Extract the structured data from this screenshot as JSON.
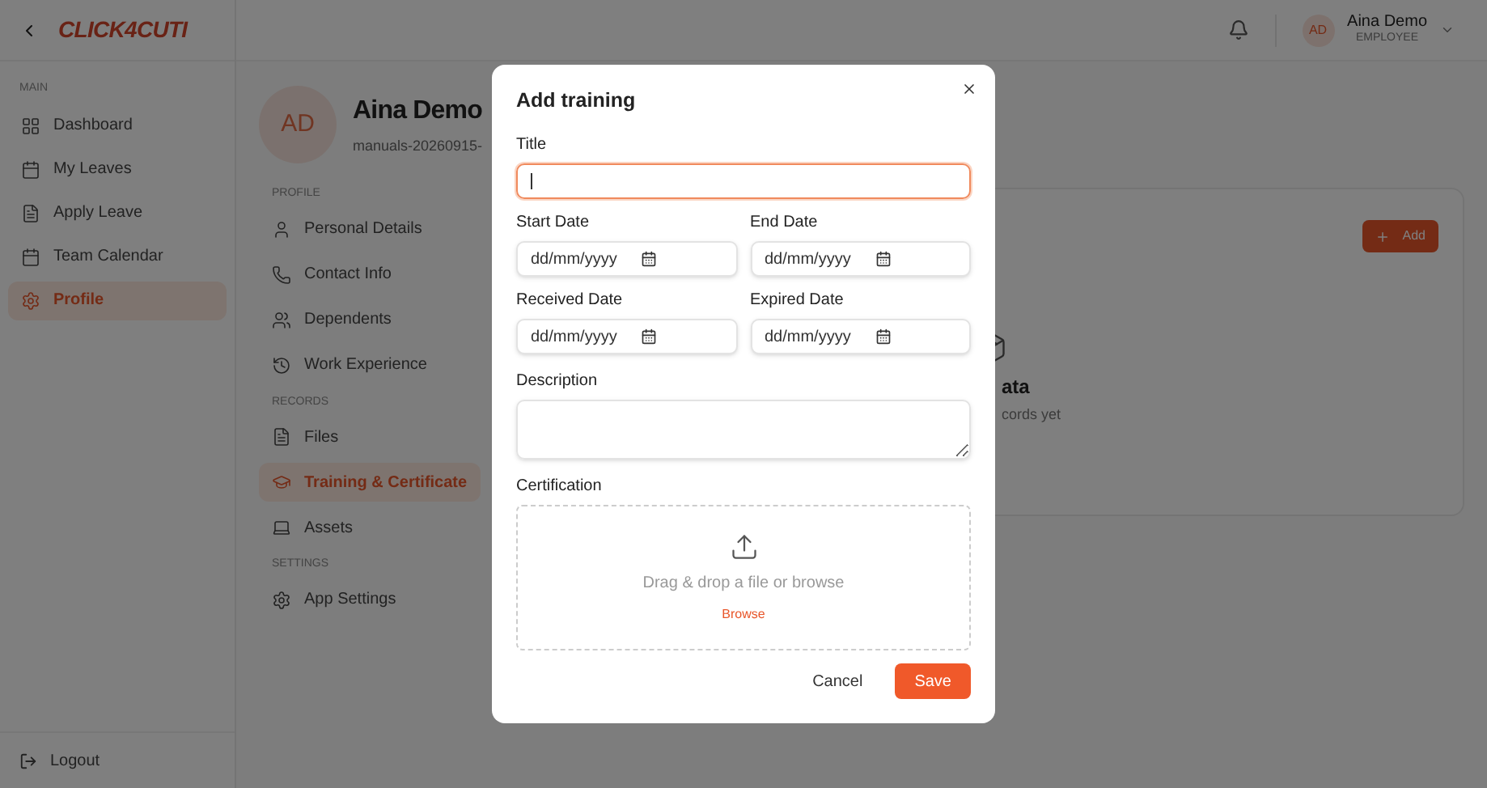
{
  "sidebar": {
    "logo": "CLICK4CUTI",
    "section": "MAIN",
    "items": [
      {
        "label": "Dashboard",
        "selected": false
      },
      {
        "label": "My Leaves",
        "selected": false
      },
      {
        "label": "Apply Leave",
        "selected": false
      },
      {
        "label": "Team Calendar",
        "selected": false
      },
      {
        "label": "Profile",
        "selected": true
      }
    ],
    "logout": "Logout"
  },
  "header": {
    "avatar": "AD",
    "name": "Aina Demo",
    "role": "EMPLOYEE"
  },
  "profile": {
    "avatar": "AD",
    "name": "Aina Demo",
    "subtitle": "manuals-20260915-",
    "sections": [
      {
        "title": "PROFILE",
        "items": [
          {
            "label": "Personal Details",
            "selected": false
          },
          {
            "label": "Contact Info",
            "selected": false
          },
          {
            "label": "Dependents",
            "selected": false
          },
          {
            "label": "Work Experience",
            "selected": false
          }
        ]
      },
      {
        "title": "RECORDS",
        "items": [
          {
            "label": "Files",
            "selected": false
          },
          {
            "label": "Training & Certificate",
            "selected": true
          },
          {
            "label": "Assets",
            "selected": false
          }
        ]
      },
      {
        "title": "SETTINGS",
        "items": [
          {
            "label": "App Settings",
            "selected": false
          }
        ]
      }
    ]
  },
  "card": {
    "add_button": "Add",
    "empty_title": "ata",
    "empty_text": "cords yet"
  },
  "modal": {
    "title": "Add training",
    "fields": [
      {
        "kind": "text",
        "label": "Title",
        "focused": true
      },
      {
        "kind": "date",
        "label": "Start Date",
        "placeholder": "dd/mm/yyyy"
      },
      {
        "kind": "date",
        "label": "End Date",
        "placeholder": "dd/mm/yyyy"
      },
      {
        "kind": "date",
        "label": "Received Date",
        "placeholder": "dd/mm/yyyy"
      },
      {
        "kind": "date",
        "label": "Expired Date",
        "placeholder": "dd/mm/yyyy"
      },
      {
        "kind": "textarea",
        "label": "Description"
      },
      {
        "kind": "upload",
        "label": "Certification",
        "hint": "Drag & drop a file or browse",
        "link": "Browse"
      }
    ],
    "cancel": "Cancel",
    "save": "Save"
  }
}
